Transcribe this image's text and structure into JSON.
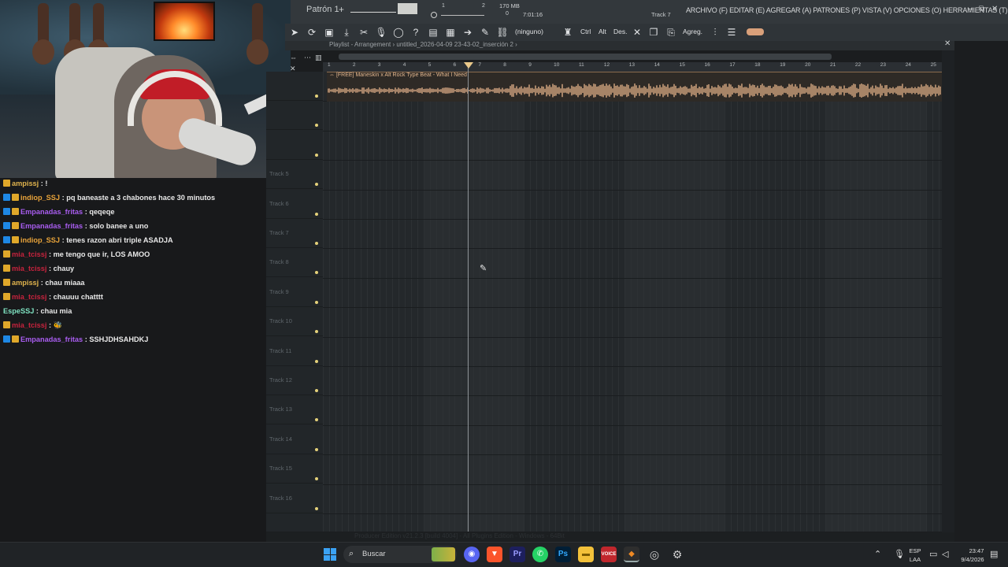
{
  "chat": {
    "messages": [
      {
        "user": "ampissj",
        "text": "!",
        "color": "#e0b34d",
        "badges": [
          "gold"
        ]
      },
      {
        "user": "indiop_SSJ",
        "text": "pq baneaste a 3 chabones hace 30 minutos",
        "color": "#e8a33a",
        "badges": [
          "blue",
          "gold"
        ]
      },
      {
        "user": "Empanadas_fritas",
        "text": "qeqeqe",
        "color": "#a95df0",
        "badges": [
          "blue",
          "gold"
        ]
      },
      {
        "user": "Empanadas_fritas",
        "text": "solo banee a uno",
        "color": "#a95df0",
        "badges": [
          "blue",
          "gold"
        ]
      },
      {
        "user": "indiop_SSJ",
        "text": "tenes razon abri triple ASADJA",
        "color": "#e8a33a",
        "badges": [
          "blue",
          "gold"
        ]
      },
      {
        "user": "mia_tcissj",
        "text": "me tengo que ir, LOS AMOO",
        "color": "#c6233d",
        "badges": [
          "gold"
        ]
      },
      {
        "user": "mia_tcissj",
        "text": "chauy",
        "color": "#c6233d",
        "badges": [
          "gold"
        ]
      },
      {
        "user": "ampissj",
        "text": "chau miaaa",
        "color": "#e0b34d",
        "badges": [
          "gold"
        ]
      },
      {
        "user": "mia_tcissj",
        "text": "chauuu chatttt",
        "color": "#c6233d",
        "badges": [
          "gold"
        ]
      },
      {
        "user": "EspeSSJ",
        "text": "chau mia",
        "color": "#7fe3c2",
        "badges": []
      },
      {
        "user": "mia_tcissj",
        "text": "🐝",
        "color": "#c6233d",
        "badges": [
          "gold"
        ]
      },
      {
        "user": "Empanadas_fritas",
        "text": "SSHJDHSAHDKJ",
        "color": "#a95df0",
        "badges": [
          "blue",
          "gold"
        ]
      }
    ]
  },
  "fl": {
    "pattern": "Patrón 1",
    "plus": "+",
    "memory": "170 MB",
    "mem_sub": "0",
    "time": "7:01:16",
    "track_indicator": "Track 7",
    "beat_num": "1",
    "beat_num2": "2",
    "menu": "ARCHIVO (F) EDITAR (E) AGREGAR (A) PATRONES (P) VISTA (V) OPCIONES (O) HERRAMIENTAS (T) AYUDA",
    "win_min": "–",
    "win_max": "⧉",
    "win_close": "✕",
    "toolbar": {
      "snap": "(ninguno)",
      "ctrl": "Ctrl",
      "alt": "Alt",
      "des": "Des.",
      "agreg": "Agreg."
    },
    "playlist_title": "Playlist - Arrangement › untitled_2026-04-09 23-43-02_inserción 2 ›",
    "clip_title": "⇔ [FREE] Maneskin x Alt Rock Type Beat - What I Need",
    "ruler": [
      "1",
      "2",
      "3",
      "4",
      "5",
      "6",
      "7",
      "8",
      "9",
      "10",
      "11",
      "12",
      "13",
      "14",
      "15",
      "16",
      "17",
      "18",
      "19",
      "20",
      "21",
      "22",
      "23",
      "24",
      "25"
    ],
    "tracks": [
      "",
      "",
      "",
      "Track 5",
      "Track 6",
      "Track 7",
      "Track 8",
      "Track 9",
      "Track 10",
      "Track 11",
      "Track 12",
      "Track 13",
      "Track 14",
      "Track 15",
      "Track 16"
    ],
    "status_ghost": "Producer Edition v21.2.3 [build 4004] - All Plugins Edition - Windows - 64Bit"
  },
  "taskbar": {
    "search_placeholder": "Buscar",
    "lang_top": "ESP",
    "lang_bottom": "LAA",
    "clock_time": "23:47",
    "clock_date": "9/4/2026"
  },
  "colors": {
    "clip": "#c49a78",
    "accent_start": "#3ba2f4",
    "track_led": "#e5d17a"
  }
}
